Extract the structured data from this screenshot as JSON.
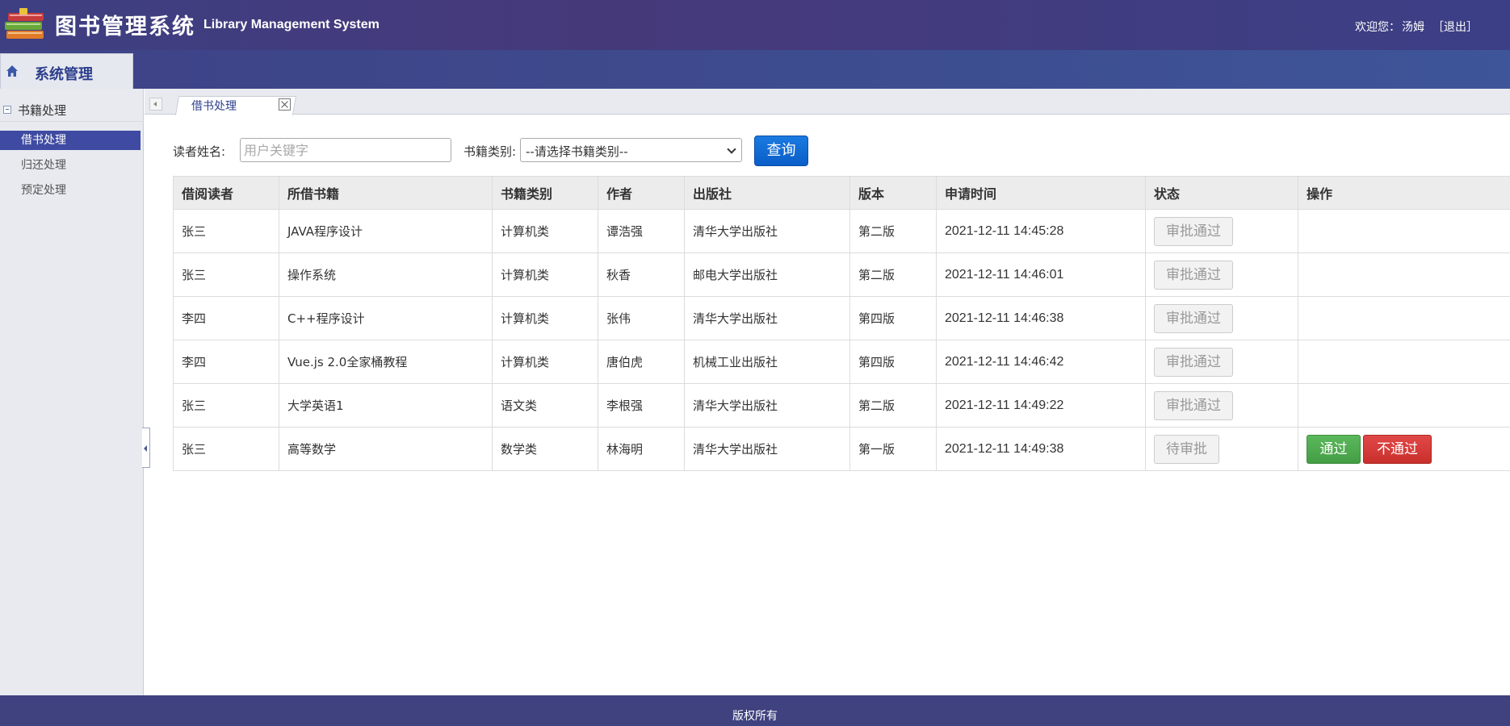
{
  "header": {
    "title_cn": "图书管理系统",
    "title_en": "Library Management System",
    "welcome_prefix": "欢迎您：",
    "user_name": "汤姆",
    "logout_label": "［退出］"
  },
  "nav": {
    "tab_label": "系统管理"
  },
  "sidebar": {
    "group_label": "书籍处理",
    "items": [
      {
        "label": "借书处理",
        "active": true
      },
      {
        "label": "归还处理",
        "active": false
      },
      {
        "label": "预定处理",
        "active": false
      }
    ]
  },
  "tabs": {
    "open_tab_label": "借书处理"
  },
  "search": {
    "reader_label": "读者姓名:",
    "reader_placeholder": "用户关键字",
    "category_label": "书籍类别:",
    "category_selected": "--请选择书籍类别--",
    "query_label": "查询"
  },
  "table": {
    "headers": [
      "借阅读者",
      "所借书籍",
      "书籍类别",
      "作者",
      "出版社",
      "版本",
      "申请时间",
      "状态",
      "操作"
    ],
    "rows": [
      {
        "reader": "张三",
        "book": "JAVA程序设计",
        "category": "计算机类",
        "author": "谭浩强",
        "publisher": "清华大学出版社",
        "edition": "第二版",
        "time": "2021-12-11 14:45:28",
        "status": "审批通过"
      },
      {
        "reader": "张三",
        "book": "操作系统",
        "category": "计算机类",
        "author": "秋香",
        "publisher": "邮电大学出版社",
        "edition": "第二版",
        "time": "2021-12-11 14:46:01",
        "status": "审批通过"
      },
      {
        "reader": "李四",
        "book": "C++程序设计",
        "category": "计算机类",
        "author": "张伟",
        "publisher": "清华大学出版社",
        "edition": "第四版",
        "time": "2021-12-11 14:46:38",
        "status": "审批通过"
      },
      {
        "reader": "李四",
        "book": "Vue.js 2.0全家桶教程",
        "category": "计算机类",
        "author": "唐伯虎",
        "publisher": "机械工业出版社",
        "edition": "第四版",
        "time": "2021-12-11 14:46:42",
        "status": "审批通过"
      },
      {
        "reader": "张三",
        "book": "大学英语1",
        "category": "语文类",
        "author": "李根强",
        "publisher": "清华大学出版社",
        "edition": "第二版",
        "time": "2021-12-11 14:49:22",
        "status": "审批通过"
      },
      {
        "reader": "张三",
        "book": "高等数学",
        "category": "数学类",
        "author": "林海明",
        "publisher": "清华大学出版社",
        "edition": "第一版",
        "time": "2021-12-11 14:49:38",
        "status": "待审批"
      }
    ],
    "approve_label": "通过",
    "reject_label": "不通过"
  },
  "footer": {
    "text": "版权所有"
  },
  "colors": {
    "header_bg": "#3d3f82",
    "sidebar_active": "#3f4ba2",
    "query_button": "#0a5ec8",
    "approve_button": "#5cb85c",
    "reject_button": "#d9534f"
  },
  "icons": {
    "logo": "books-stack-icon",
    "nav_home": "home-icon",
    "group_toggle": "collapse-minus-icon",
    "tab_close": "close-icon",
    "tab_scroll": "chevron-left-icon",
    "select_arrow": "chevron-down-icon"
  }
}
